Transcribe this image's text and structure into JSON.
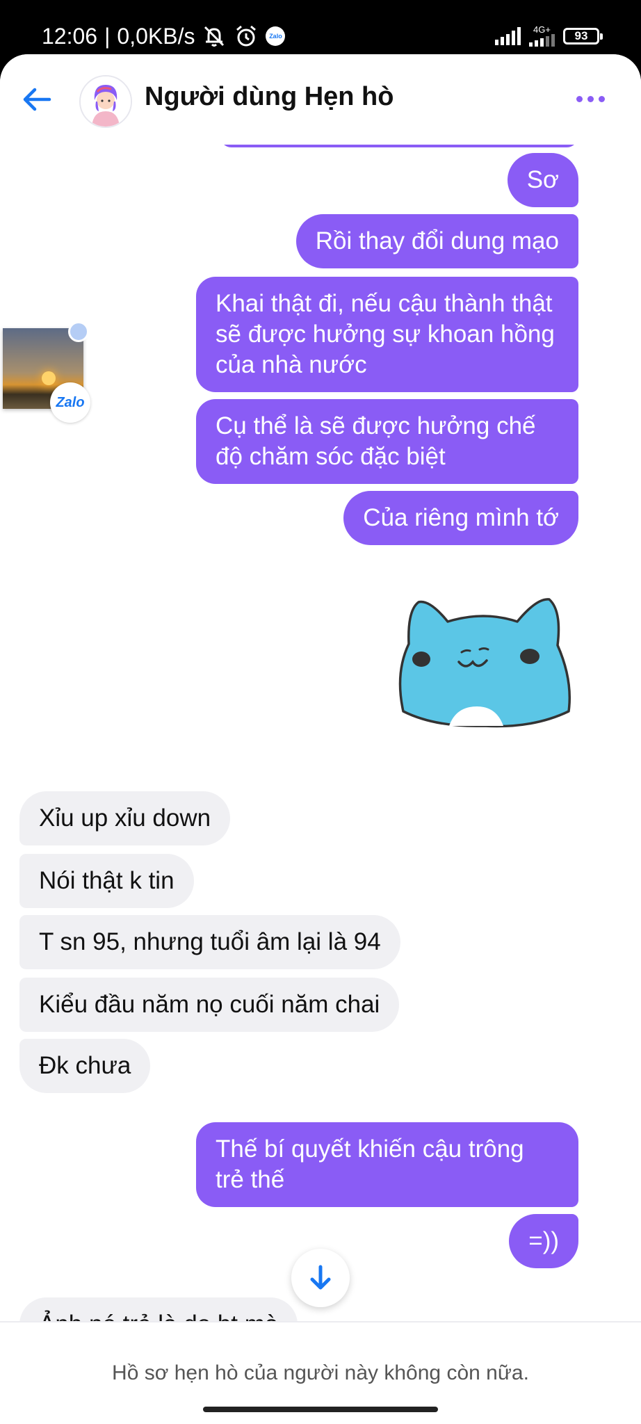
{
  "status_bar": {
    "time": "12:06",
    "network_speed": "0,0KB/s",
    "network_type": "4G+",
    "battery": "93",
    "notification_app": "Zalo"
  },
  "header": {
    "title": "Người dùng Hẹn hò"
  },
  "messages": [
    {
      "direction": "outgoing",
      "text": "Sơ"
    },
    {
      "direction": "outgoing",
      "text": "Rồi thay đổi dung mạo"
    },
    {
      "direction": "outgoing",
      "text": "Khai thật đi, nếu cậu thành thật sẽ được hưởng sự khoan hồng của nhà nước"
    },
    {
      "direction": "outgoing",
      "text": "Cụ thể là sẽ được hưởng chế độ chăm sóc đặc biệt"
    },
    {
      "direction": "outgoing",
      "text": "Của riêng mình tớ"
    },
    {
      "direction": "outgoing",
      "type": "sticker",
      "sticker": "blue-cat-sticker"
    },
    {
      "direction": "incoming",
      "text": "Xỉu up xỉu down"
    },
    {
      "direction": "incoming",
      "text": "Nói thật k tin"
    },
    {
      "direction": "incoming",
      "text": "T sn 95, nhưng tuổi âm lại là 94"
    },
    {
      "direction": "incoming",
      "text": "Kiểu đầu năm nọ cuối năm chai"
    },
    {
      "direction": "incoming",
      "text": "Đk chưa"
    },
    {
      "direction": "outgoing",
      "text": "Thế bí quyết khiến cậu trông trẻ thế"
    },
    {
      "direction": "outgoing",
      "text": "=))"
    },
    {
      "direction": "incoming",
      "text": "Ảnh nó trẻ là do bt mà"
    }
  ],
  "chat_head": {
    "badge": "Zalo"
  },
  "footer": {
    "notice": "Hồ sơ hẹn hò của người này không còn nữa."
  },
  "colors": {
    "outgoing_bubble": "#8a5cf5",
    "incoming_bubble": "#f0f0f3",
    "accent_blue": "#1877f2"
  }
}
